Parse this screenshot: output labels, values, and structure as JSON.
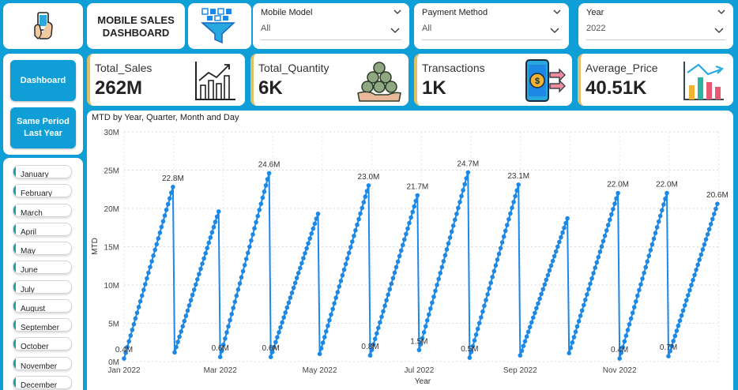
{
  "header": {
    "title_line1": "MOBILE SALES",
    "title_line2": "DASHBOARD"
  },
  "icons": {
    "logo": "phone-in-hand-icon",
    "filter": "filter-funnel-icon",
    "sales": "bar-chart-up-icon",
    "quantity": "money-bags-icon",
    "transactions": "phone-transfer-icon",
    "average_price": "column-chart-icon"
  },
  "slicers": [
    {
      "title": "Mobile Model",
      "value": "All"
    },
    {
      "title": "Payment Method",
      "value": "All"
    },
    {
      "title": "Year",
      "value": "2022"
    }
  ],
  "nav": {
    "dashboard": "Dashboard",
    "same_period_line1": "Same Period",
    "same_period_line2": "Last Year"
  },
  "kpis": [
    {
      "label": "Total_Sales",
      "value": "262M"
    },
    {
      "label": "Total_Quantity",
      "value": "6K"
    },
    {
      "label": "Transactions",
      "value": "1K"
    },
    {
      "label": "Average_Price",
      "value": "40.51K"
    }
  ],
  "months": [
    "January",
    "February",
    "March",
    "April",
    "May",
    "June",
    "July",
    "August",
    "September",
    "October",
    "November",
    "December"
  ],
  "colors": {
    "accent": "#0f9fd6",
    "line": "#1e88e5",
    "kpi_border": "#e0c16a",
    "month_bar": "#17a3a8"
  },
  "chart_data": {
    "type": "line",
    "title": "MTD by Year, Quarter, Month and Day",
    "xlabel": "Year",
    "ylabel": "MTD",
    "ylim": [
      0,
      30
    ],
    "y_unit": "M",
    "yticks": [
      "0M",
      "5M",
      "10M",
      "15M",
      "20M",
      "25M",
      "30M"
    ],
    "xticks": [
      "Jan 2022",
      "Mar 2022",
      "May 2022",
      "Jul 2022",
      "Sep 2022",
      "Nov 2022"
    ],
    "grid": true,
    "series": [
      {
        "month_start_labels": [
          "0.4M",
          null,
          "0.6M",
          "0.6M",
          null,
          "0.8M",
          "1.5M",
          "0.5M",
          null,
          null,
          "0.4M",
          "0.7M"
        ],
        "month_end_labels": [
          "22.8M",
          null,
          "24.6M",
          null,
          "23.0M",
          "21.7M",
          "24.7M",
          "23.1M",
          null,
          "22.0M",
          "22.0M",
          "20.6M"
        ],
        "month_start_values": [
          0.4,
          1.2,
          0.6,
          0.6,
          1.0,
          0.8,
          1.5,
          0.5,
          0.8,
          1.1,
          0.4,
          0.7
        ],
        "month_end_values": [
          22.8,
          19.6,
          24.6,
          19.3,
          23.0,
          21.7,
          24.7,
          23.1,
          18.7,
          22.0,
          22.0,
          20.6
        ],
        "month_days": [
          31,
          28,
          31,
          30,
          31,
          30,
          31,
          31,
          30,
          31,
          30,
          31
        ]
      }
    ]
  }
}
